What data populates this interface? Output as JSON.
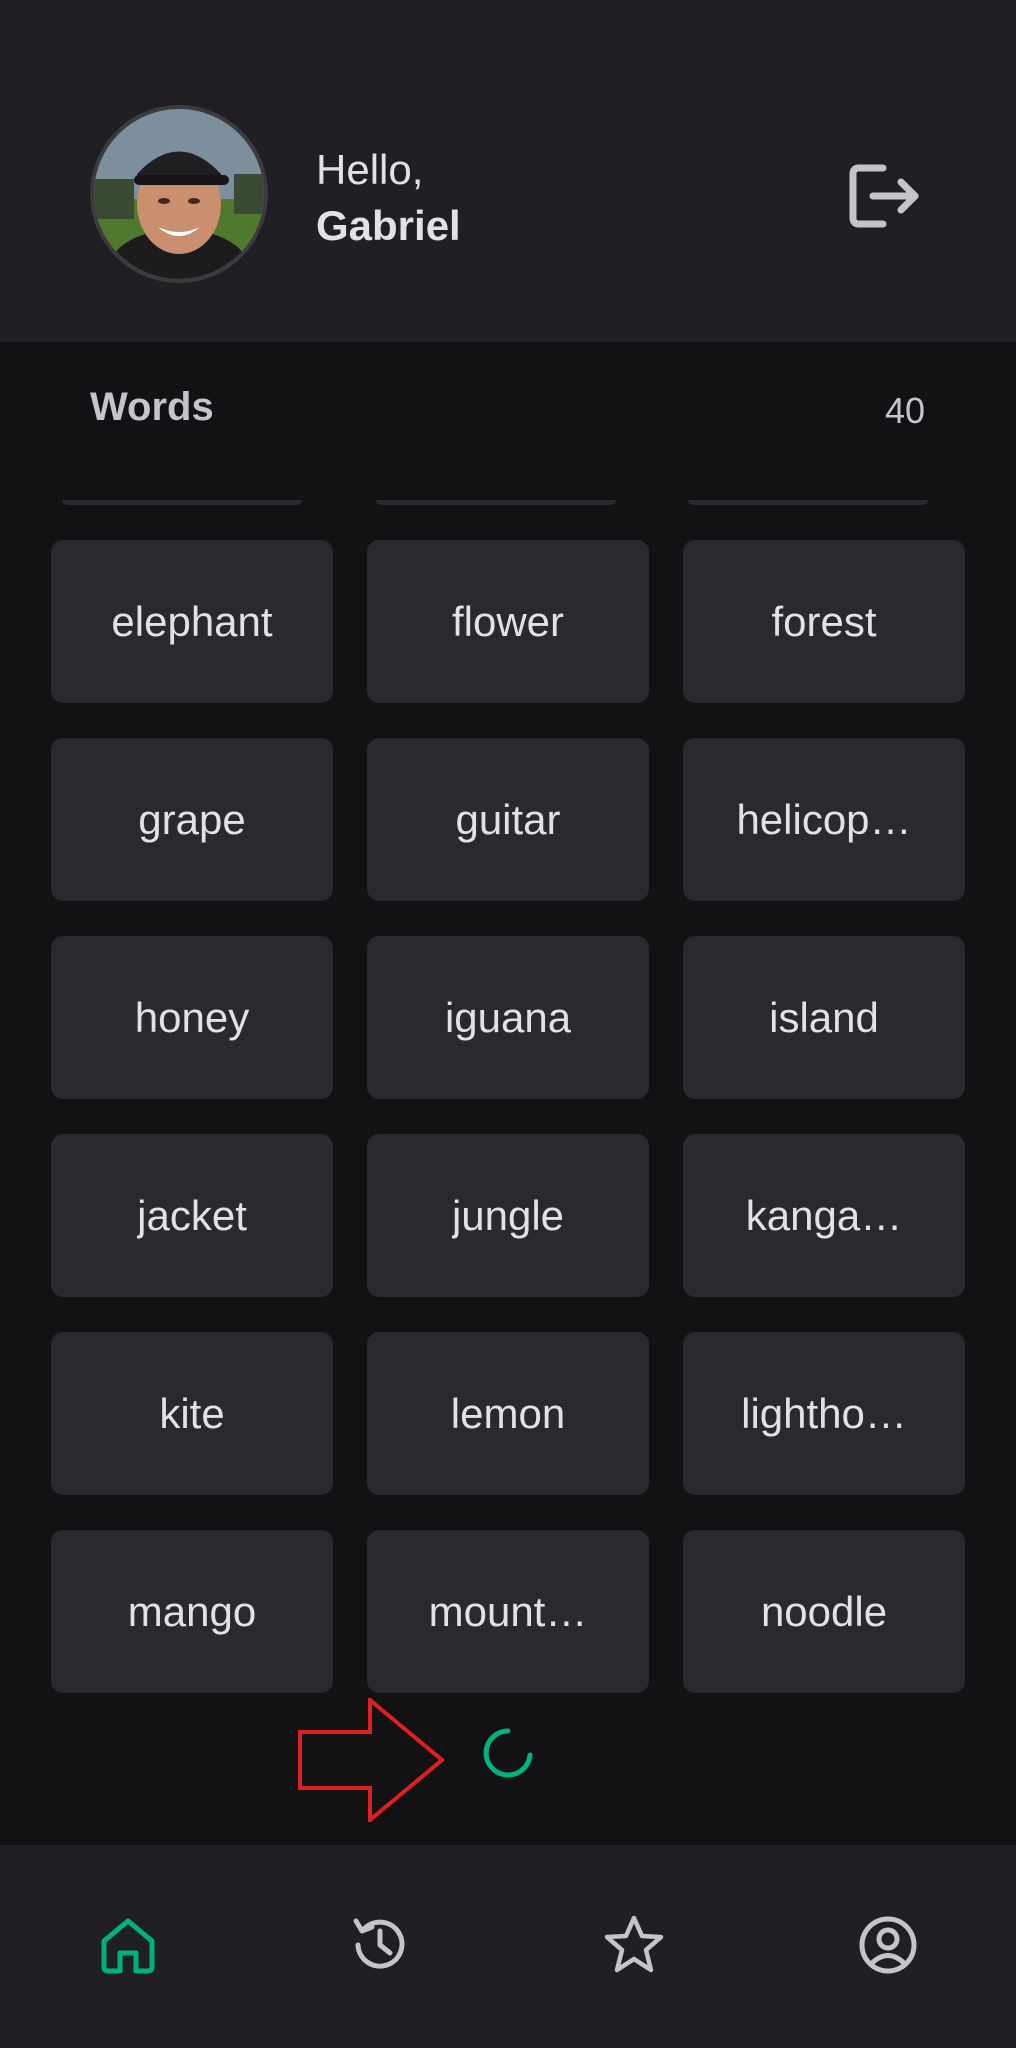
{
  "header": {
    "greeting": "Hello,",
    "user_name": "Gabriel",
    "avatar_icon": "user-avatar-photo",
    "logout_icon": "logout-icon"
  },
  "words": {
    "title": "Words",
    "count": "40",
    "items": [
      "elephant",
      "flower",
      "forest",
      "grape",
      "guitar",
      "helicop…",
      "honey",
      "iguana",
      "island",
      "jacket",
      "jungle",
      "kanga…",
      "kite",
      "lemon",
      "lightho…",
      "mango",
      "mount…",
      "noodle"
    ]
  },
  "loading": {
    "spinner_icon": "loading-spinner-icon",
    "annotation": "red-arrow-annotation"
  },
  "nav": {
    "items": [
      {
        "icon": "home-icon",
        "active": true
      },
      {
        "icon": "history-icon",
        "active": false
      },
      {
        "icon": "star-icon",
        "active": false
      },
      {
        "icon": "user-circle-icon",
        "active": false
      }
    ]
  },
  "colors": {
    "background": "#121214",
    "surface": "#202024",
    "card": "#29292e",
    "text": "#e1e1e6",
    "muted": "#c4c4cc",
    "accent": "#00b37e",
    "annotation": "#e02020"
  }
}
